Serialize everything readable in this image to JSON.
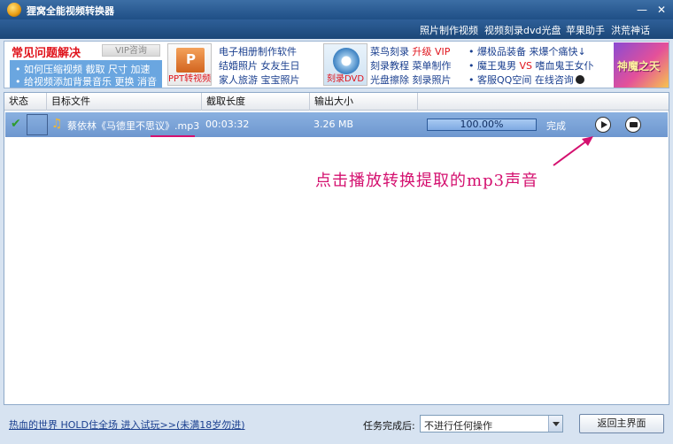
{
  "window": {
    "title": "狸窝全能视频转换器",
    "minimize_glyph": "—",
    "close_glyph": "✕"
  },
  "top_links": [
    "照片制作视频",
    "视频刻录dvd光盘",
    "苹果助手",
    "洪荒神话"
  ],
  "banner": {
    "faq_title": "常见问题解决",
    "vip_tab": "VIP咨询",
    "faq_lines": [
      "• 如何压缩视频  截取  尺寸  加速",
      "• 给视频添加背景音乐  更换  消音"
    ],
    "ppt_caption": "PPT转视频",
    "col1": [
      "电子相册制作软件",
      "结婚照片  女友生日",
      "家人旅游  宝宝照片"
    ],
    "dvd_caption": "刻录DVD",
    "col2_line1_a": "菜鸟刻录",
    "col2_line1_b": "升级 VIP",
    "col2_line2": "刻录教程  菜单制作",
    "col2_line3": "光盘擦除  刻录照片",
    "col3_line1": "爆极品装备  来爆个痛快↓",
    "col3_line2_a": "魔王鬼男",
    "col3_line2_vs": "VS",
    "col3_line2_b": "嗜血鬼王女仆",
    "col3_line3": "客服QQ空间  在线咨询",
    "game_text": "神魔之天"
  },
  "list": {
    "columns": [
      "状态",
      "目标文件",
      "截取长度",
      "输出大小"
    ],
    "rows": [
      {
        "status_icon": "check-icon",
        "filename": "蔡依林《马德里不思议》.mp3",
        "duration": "00:03:32",
        "size": "3.26 MB",
        "progress": 100,
        "progress_text": "100.00%",
        "status_text": "完成"
      }
    ]
  },
  "annotation": "点击播放转换提取的mp3声音",
  "bottom": {
    "ad_link": "热血的世界 HOLD住全场 进入试玩>>(未满18岁勿进)",
    "after_label": "任务完成后:",
    "after_value": "不进行任何操作",
    "return_button": "返回主界面"
  },
  "colors": {
    "accent_pink": "#d4106f",
    "row_selected": "#7aa2d8",
    "titlebar": "#2b5a92"
  }
}
